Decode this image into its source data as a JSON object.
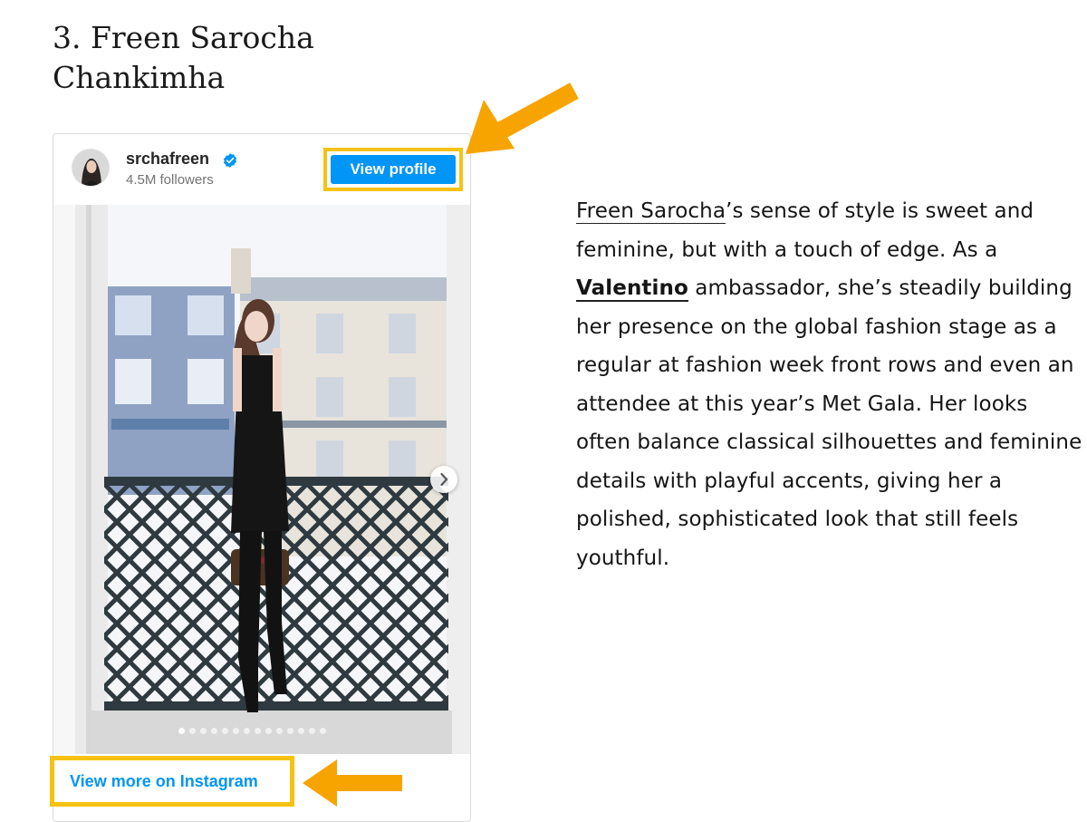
{
  "heading": {
    "line1": "3. Freen Sarocha",
    "line2": "Chankimha"
  },
  "embed": {
    "username": "srchafreen",
    "followers": "4.5M followers",
    "view_profile_label": "View profile",
    "view_more_label": "View more on Instagram",
    "carousel_dots_total": 14,
    "carousel_active_index": 0
  },
  "article": {
    "link_name": "Freen Sarocha",
    "text1": "’s sense of style is sweet and feminine, but with a touch of edge. As a ",
    "link_brand": "Valentino",
    "text2": " ambassador, she’s steadily building her presence on the global fashion stage as a regular at fashion week front rows and even an attendee at this year’s Met Gala. Her looks often balance classical silhouettes and feminine details with playful accents, giving her a polished, sophisticated look that still feels youthful."
  },
  "colors": {
    "instagram_blue": "#0095f6",
    "highlight_yellow": "#f6c212",
    "arrow_orange": "#f7a400"
  },
  "icons": [
    "verified-badge-icon",
    "chevron-right-icon",
    "arrow-icon"
  ]
}
